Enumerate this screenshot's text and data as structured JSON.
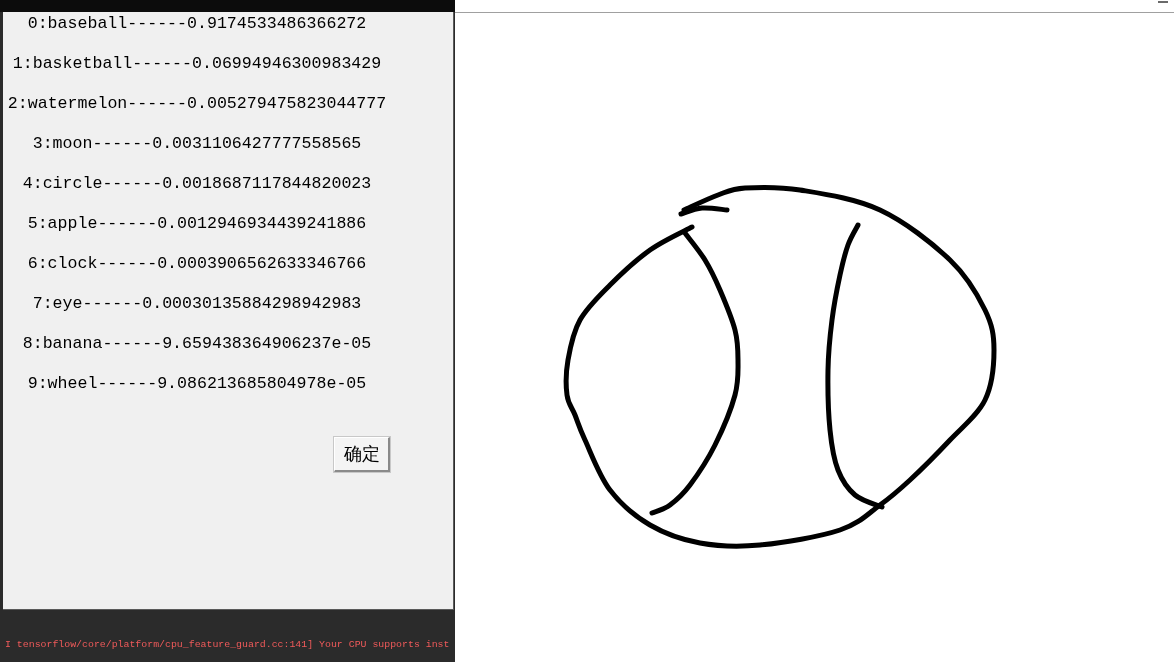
{
  "result_dialog": {
    "results": [
      "0:baseball------0.9174533486366272",
      "1:basketball------0.06994946300983429",
      "2:watermelon------0.005279475823044777",
      "3:moon------0.0031106427777558565",
      "4:circle------0.0018687117844820023",
      "5:apple------0.0012946934439241886",
      "6:clock------0.0003906562633346766",
      "7:eye------0.00030135884298942983",
      "8:banana------9.659438364906237e-05",
      "9:wheel------9.086213685804978e-05"
    ],
    "button": "确定"
  },
  "console": {
    "lines": [
      "I tensorflow/core/platform/cpu_feature_guard.cc:141] Your CPU supports inst"
    ]
  }
}
